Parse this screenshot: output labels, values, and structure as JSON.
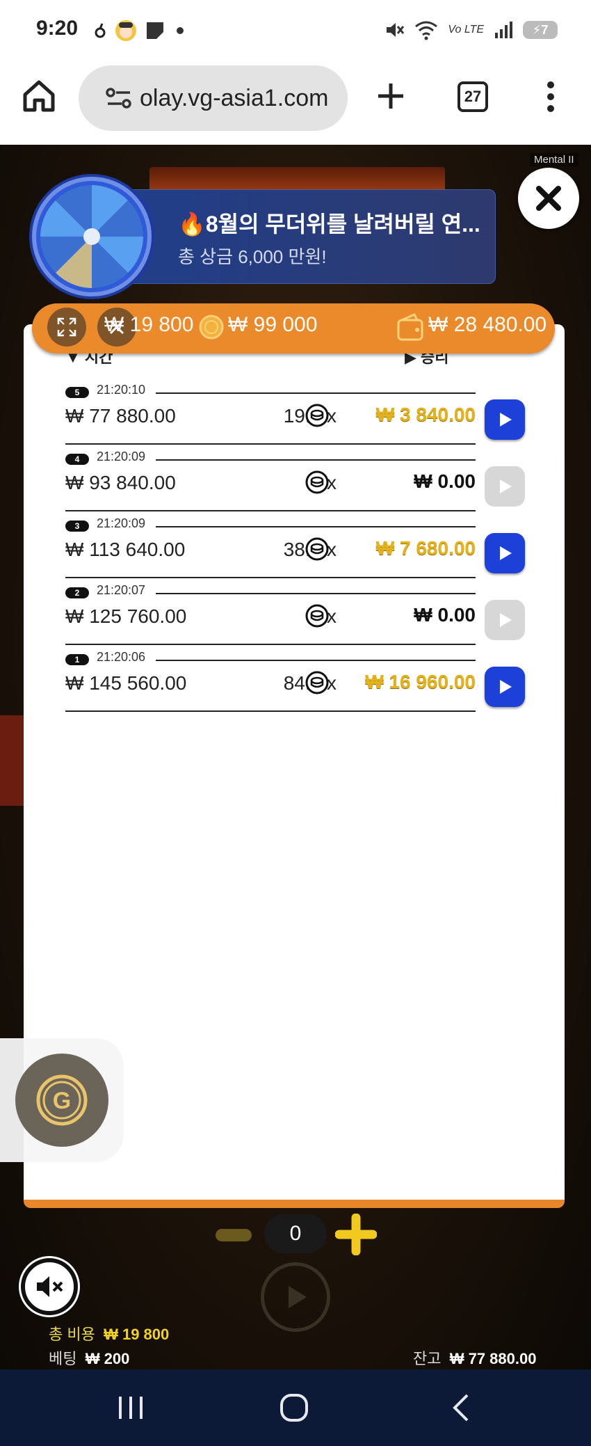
{
  "status_bar": {
    "time": "9:20",
    "battery": "7",
    "network_label": "Vo LTE",
    "icons": [
      "notification-icon",
      "avatar-icon",
      "app-icon",
      "dot-icon",
      "mute-icon",
      "wifi-icon",
      "signal-icon",
      "battery-icon"
    ]
  },
  "browser": {
    "url": "olay.vg-asia1.com",
    "tab_count": "27"
  },
  "game": {
    "mental_label": "Mental II",
    "promo": {
      "title": "8월의 무더위를 날려버릴 연...",
      "subtitle": "총 상금 6,000 만원!"
    },
    "top_bar": {
      "bet_value": "₩ 19 800",
      "coin_value": "₩ 99 000",
      "wallet_value": "₩ 28 480.00"
    },
    "history": {
      "header_time": "시간",
      "header_win": "승리",
      "rows": [
        {
          "num": "5",
          "time": "21:20:10",
          "balance": "₩ 77 880.00",
          "multiplier": "19.2 x",
          "win": "₩ 3 840.00",
          "win_style": "gold",
          "replay": "active"
        },
        {
          "num": "4",
          "time": "21:20:09",
          "balance": "₩ 93 840.00",
          "multiplier": "0 x",
          "win": "₩ 0.00",
          "win_style": "black",
          "replay": "inactive"
        },
        {
          "num": "3",
          "time": "21:20:09",
          "balance": "₩ 113 640.00",
          "multiplier": "38.4 x",
          "win": "₩ 7 680.00",
          "win_style": "gold",
          "replay": "active"
        },
        {
          "num": "2",
          "time": "21:20:07",
          "balance": "₩ 125 760.00",
          "multiplier": "0 x",
          "win": "₩ 0.00",
          "win_style": "black",
          "replay": "inactive"
        },
        {
          "num": "1",
          "time": "21:20:06",
          "balance": "₩ 145 560.00",
          "multiplier": "84.8 x",
          "win": "₩ 16 960.00",
          "win_style": "gold",
          "replay": "active"
        }
      ]
    },
    "g_button_letter": "G",
    "stepper_value": "0",
    "total_cost_label": "총 비용",
    "total_cost_value": "₩ 19 800",
    "bet_label": "베팅",
    "bet_value": "₩ 200",
    "balance_label": "잔고",
    "balance_value": "₩ 77 880.00"
  },
  "colors": {
    "accent_orange": "#ea8a2b",
    "win_gold": "#e5b21a",
    "replay_blue": "#1d40d8",
    "nav_bg": "#0c1937"
  }
}
